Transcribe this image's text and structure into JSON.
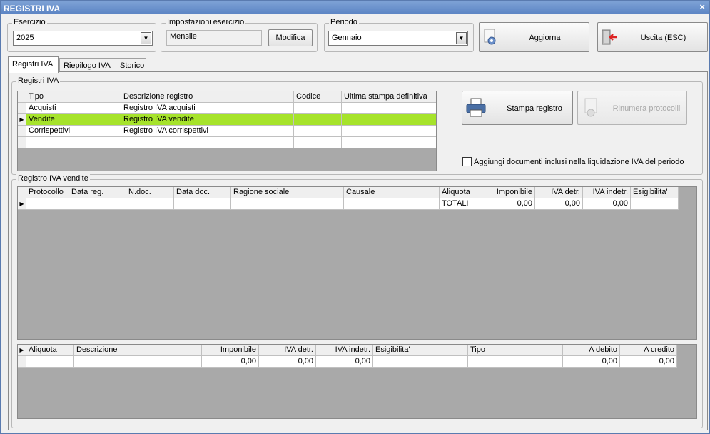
{
  "window": {
    "title": "REGISTRI IVA",
    "close_glyph": "×"
  },
  "esercizio": {
    "label": "Esercizio",
    "value": "2025"
  },
  "impostazioni": {
    "label": "Impostazioni esercizio",
    "value": "Mensile",
    "button": "Modifica"
  },
  "periodo": {
    "label": "Periodo",
    "value": "Gennaio"
  },
  "toolbar": {
    "aggiorna": "Aggiorna",
    "uscita": "Uscita (ESC)"
  },
  "tabs": [
    {
      "label": "Registri IVA",
      "active": true
    },
    {
      "label": "Riepilogo IVA",
      "active": false
    },
    {
      "label": "Storico",
      "active": false
    }
  ],
  "registri_group": {
    "label": "Registri IVA",
    "columns": [
      "Tipo",
      "Descrizione registro",
      "Codice",
      "Ultima stampa definitiva"
    ],
    "rows": [
      [
        "Acquisti",
        "Registro IVA acquisti",
        "",
        ""
      ],
      [
        "Vendite",
        "Registro IVA vendite",
        "",
        ""
      ],
      [
        "Corrispettivi",
        "Registro IVA corrispettivi",
        "",
        ""
      ]
    ],
    "selected_row": 1,
    "stampa_button": "Stampa registro",
    "rinumera_button": "Rinumera protocolli",
    "checkbox_label": "Aggiungi documenti inclusi nella liquidazione IVA del periodo"
  },
  "vendite_group": {
    "label": "Registro IVA vendite",
    "columns": [
      "Protocollo",
      "Data reg.",
      "N.doc.",
      "Data doc.",
      "Ragione sociale",
      "Causale",
      "Aliquota",
      "Imponibile",
      "IVA detr.",
      "IVA indetr.",
      "Esigibilita'"
    ],
    "totals_row": [
      "",
      "",
      "",
      "",
      "",
      "",
      "TOTALI",
      "0,00",
      "0,00",
      "0,00",
      ""
    ]
  },
  "riepilogo_grid": {
    "columns": [
      "Aliquota",
      "Descrizione",
      "Imponibile",
      "IVA detr.",
      "IVA indetr.",
      "Esigibilita'",
      "Tipo",
      "A debito",
      "A credito"
    ],
    "row": [
      "",
      "",
      "0,00",
      "0,00",
      "0,00",
      "",
      "",
      "0,00",
      "0,00"
    ]
  },
  "colors": {
    "selected_row": "#a6e32b",
    "titlebar": "#5b84c4",
    "grid_bg": "#a9a9a9"
  },
  "icons": {
    "dropdown": "▼",
    "row_pointer": "▶"
  }
}
